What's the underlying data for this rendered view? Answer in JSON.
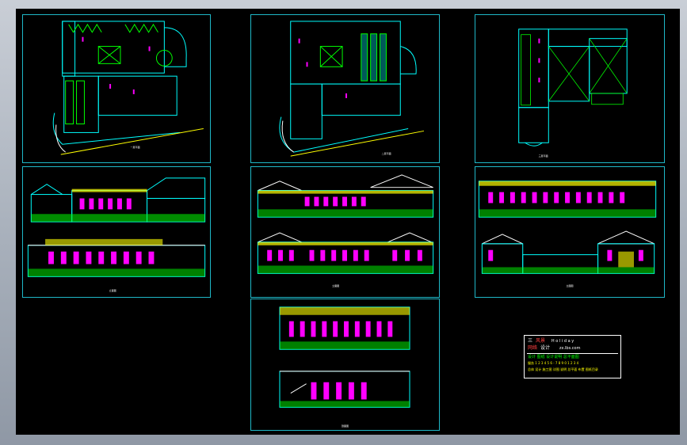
{
  "colors": {
    "background": "#000000",
    "sheet_border": "#1fb8c8",
    "cyan": "#00ffff",
    "green": "#00ff00",
    "magenta": "#ff00ff",
    "yellow": "#ffff00",
    "white": "#ffffff"
  },
  "sheets": [
    {
      "id": "plan-1",
      "kind": "plan",
      "caption": "一层平面"
    },
    {
      "id": "plan-2",
      "kind": "plan",
      "caption": "二层平面"
    },
    {
      "id": "plan-3",
      "kind": "plan",
      "caption": "三层平面"
    },
    {
      "id": "elev-1",
      "kind": "elevation",
      "caption": "立面图"
    },
    {
      "id": "elev-2",
      "kind": "elevation",
      "caption": "立面图"
    },
    {
      "id": "elev-3",
      "kind": "elevation",
      "caption": "立面图"
    },
    {
      "id": "elev-4",
      "kind": "section",
      "caption": "剖面图"
    }
  ],
  "title_block": {
    "line1_label": "三",
    "line1_text": "风景",
    "line1_en": "H o l i d a y",
    "line2_label": "网络",
    "line2_text": "设计",
    "line2_url": "zx.lbs.com",
    "line3": "设计 图纸 设计说明 总平面图",
    "line4": "服务 1 2 3 4 5 6 - 7 8 9 0 1 2 3 4",
    "line5": "总体 设计 施工图 详图 说明 总平面 布置 图纸目录"
  }
}
